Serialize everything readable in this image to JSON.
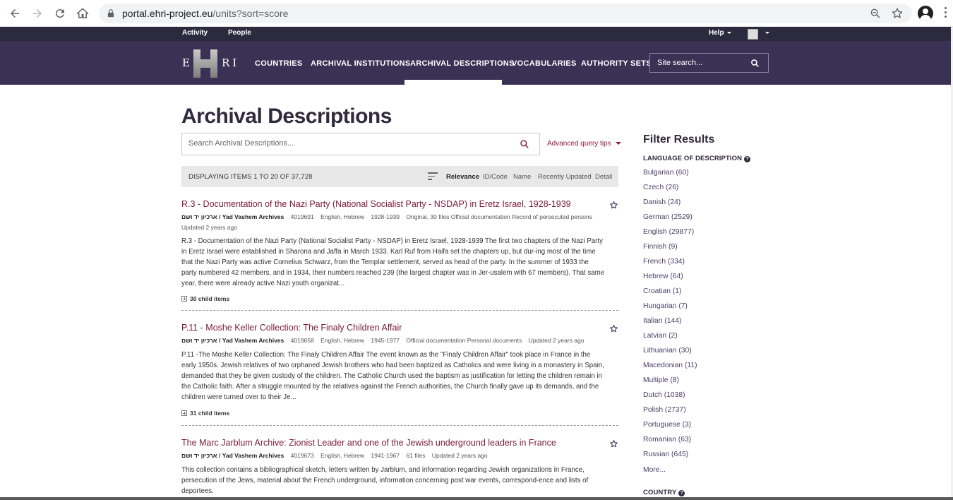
{
  "browser": {
    "url_host": "portal.ehri-project.eu",
    "url_path": "/units?sort=score"
  },
  "util_bar": {
    "activity": "Activity",
    "people": "People",
    "help": "Help"
  },
  "logo": {
    "left": "E",
    "right": "RI"
  },
  "nav": {
    "items": [
      "COUNTRIES",
      "ARCHIVAL INSTITUTIONS",
      "ARCHIVAL DESCRIPTIONS",
      "VOCABULARIES",
      "AUTHORITY SETS"
    ],
    "active": "ARCHIVAL DESCRIPTIONS",
    "search_placeholder": "Site search..."
  },
  "page": {
    "title": "Archival Descriptions",
    "search_placeholder": "Search Archival Descriptions...",
    "advanced_tips": "Advanced query tips"
  },
  "results_bar": {
    "count": "DISPLAYING ITEMS 1 TO 20 OF 37,728",
    "sort_options": [
      "Relevance",
      "ID/Code",
      "Name",
      "Recently Updated",
      "Detail"
    ],
    "active_sort": "Relevance"
  },
  "results": [
    {
      "title": "R.3 - Documentation of the Nazi Party (National Socialist Party - NSDAP) in Eretz Israel, 1928-1939",
      "holder": "ארכיון יד ושם / Yad Vashem Archives",
      "id": "4019691",
      "languages": "English, Hebrew",
      "dates": "1928-1939",
      "extent": "Original, 30 files Official documentation Record of persecuted persons",
      "updated": "Updated 2 years ago",
      "description": "R.3 - Documentation of the Nazi Party (National Socialist Party - NSDAP) in Eretz Israel, 1928-1939 The first two chapters of the Nazi Party in Eretz Israel were established in Sharona and Jaffa in March 1933. Karl Ruf from Haifa set the chapters up, but dur-ing most of the time that the Nazi Party was active Cornelius Schwarz, from the Templar settlement, served as head of the party. In the summer of 1933 the party numbered 42 members, and in 1934, their numbers reached 239 (the largest chapter was in Jer-usalem with 67 members). That same year, there were already active Nazi youth organizat...",
      "children": "30 child items"
    },
    {
      "title": "P.11 - Moshe Keller Collection: The Finaly Children Affair",
      "holder": "ארכיון יד ושם / Yad Vashem Archives",
      "id": "4019658",
      "languages": "English, Hebrew",
      "dates": "1945-1977",
      "extent": "Official documentation Personal documents",
      "updated": "Updated 2 years ago",
      "description": "P.11 -The Moshe Keller Collection: The Finaly Children Affair The event known as the \"Finaly Children Affair\" took place in France in the early 1950s. Jewish relatives of two orphaned Jewish brothers who had been baptized as Catholics and were living in a monastery in Spain, demanded that they be given custody of the children. The Catholic Church used the baptism as justification for letting the children remain in the Catholic faith. After a struggle mounted by the relatives against the French authorities, the Church finally gave up its demands, and the children were turned over to their Je...",
      "children": "31 child items"
    },
    {
      "title": "The Marc Jarblum Archive: Zionist Leader and one of the Jewish underground leaders in France",
      "holder": "ארכיון יד ושם / Yad Vashem Archives",
      "id": "4019673",
      "languages": "English, Hebrew",
      "dates": "1941-1967",
      "extent": "61 files",
      "updated": "Updated 2 years ago",
      "description": "This collection contains a bibliographical sketch, letters written by Jarblum, and information regarding Jewish organizations in France, persecution of the Jews, material about the French underground, information concerning post war events, correspond-ence and lists of deportees.",
      "children": ""
    }
  ],
  "sidebar": {
    "title": "Filter Results",
    "language_heading": "LANGUAGE OF DESCRIPTION",
    "languages": [
      "Bulgarian (60)",
      "Czech (26)",
      "Danish (24)",
      "German (2529)",
      "English (29877)",
      "Finnish (9)",
      "French (334)",
      "Hebrew (64)",
      "Croatian (1)",
      "Hungarian (7)",
      "Italian (144)",
      "Latvian (2)",
      "Lithuanian (30)",
      "Macedonian (11)",
      "Multiple (8)",
      "Dutch (1038)",
      "Polish (2737)",
      "Portuguese (3)",
      "Romanian (63)",
      "Russian (645)"
    ],
    "more": "More...",
    "country_heading": "COUNTRY",
    "help_mark": "?"
  },
  "icons": {
    "back": "arrow-left-icon",
    "forward": "arrow-right-icon",
    "reload": "reload-icon",
    "home": "home-icon",
    "lock": "lock-icon",
    "zoom": "zoom-icon",
    "bookmark": "star-icon",
    "search": "search-icon",
    "favourite": "star-outline-icon"
  },
  "colors": {
    "nav_bg": "#3b3155",
    "util_bg": "#2b2a3f",
    "link": "#7a1a3a",
    "facet": "#4a3e66"
  }
}
